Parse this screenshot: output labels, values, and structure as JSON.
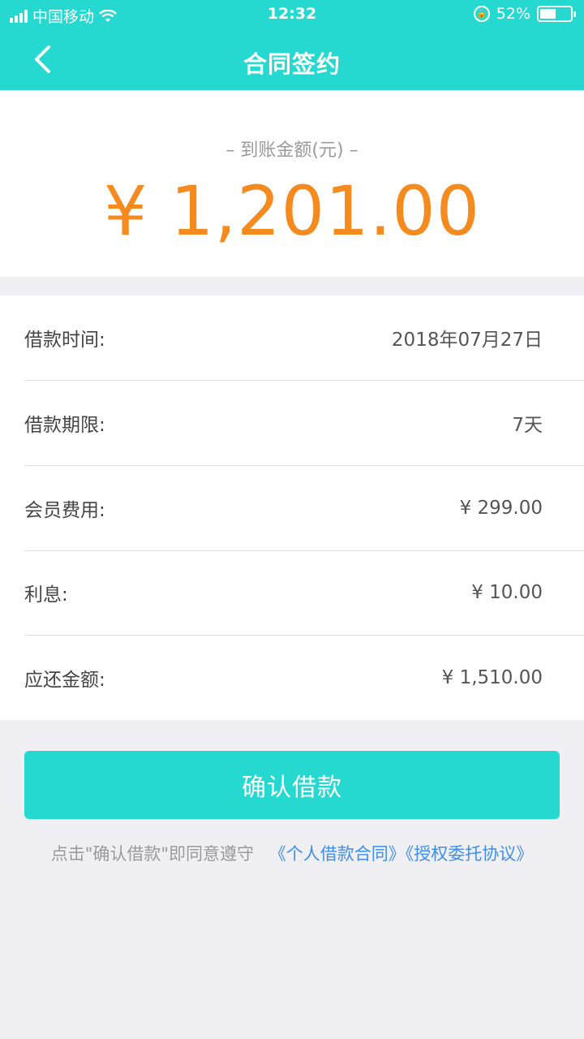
{
  "status_bar": {
    "carrier": "中国移动",
    "time": "12:32",
    "battery_percent": "52%",
    "battery_level": 0.52
  },
  "nav": {
    "title": "合同签约",
    "back_icon": "chevron-left-icon"
  },
  "amount": {
    "label": "– 到账金额(元) –",
    "value": "¥ 1,201.00"
  },
  "details": [
    {
      "label": "借款时间:",
      "value": "2018年07月27日"
    },
    {
      "label": "借款期限:",
      "value": "7天"
    },
    {
      "label": "会员费用:",
      "value": "¥ 299.00"
    },
    {
      "label": "利息:",
      "value": "¥ 10.00"
    },
    {
      "label": "应还金额:",
      "value": "¥ 1,510.00"
    }
  ],
  "confirm_button": "确认借款",
  "agreement": {
    "prefix": "点击\"确认借款\"即同意遵守",
    "link1": "《个人借款合同》",
    "link2": "《授权委托协议》"
  },
  "colors": {
    "accent": "#26d9d0",
    "amount": "#f58a1f",
    "link": "#3f8fe8"
  }
}
